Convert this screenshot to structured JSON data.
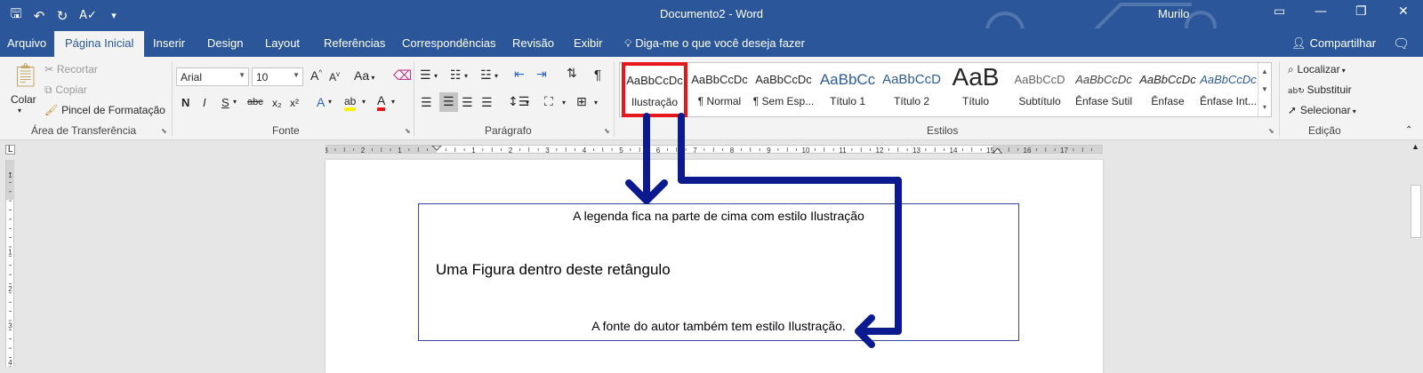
{
  "window": {
    "title": "Documento2 - Word",
    "user": "Murilo",
    "qat_icons": [
      "save-icon",
      "undo-icon",
      "redo-icon",
      "spelling-icon",
      "customize-icon"
    ],
    "controls": [
      "ribbon-display-icon",
      "minimize-icon",
      "restore-icon",
      "close-icon"
    ]
  },
  "tabs": [
    {
      "label": "Arquivo"
    },
    {
      "label": "Página Inicial",
      "active": true
    },
    {
      "label": "Inserir"
    },
    {
      "label": "Design"
    },
    {
      "label": "Layout"
    },
    {
      "label": "Referências"
    },
    {
      "label": "Correspondências"
    },
    {
      "label": "Revisão"
    },
    {
      "label": "Exibir"
    }
  ],
  "tell_me": "Diga-me o que você deseja fazer",
  "share": "Compartilhar",
  "clipboard": {
    "paste": "Colar",
    "cut": "Recortar",
    "copy": "Copiar",
    "format_painter": "Pincel de Formatação",
    "group": "Área de Transferência"
  },
  "font": {
    "name": "Arial",
    "size": "10",
    "bold": "N",
    "italic": "I",
    "underline": "S",
    "strike": "abc",
    "subscript": "x₂",
    "superscript": "x²",
    "change_case": "Aa",
    "grow": "A",
    "shrink": "A",
    "effects": "A",
    "highlight": "ab",
    "color": "A",
    "group": "Fonte"
  },
  "paragraph": {
    "group": "Parágrafo",
    "pilcrow": "¶"
  },
  "styles": {
    "group": "Estilos",
    "items": [
      {
        "preview": "AaBbCcDc",
        "label": "Ilustração",
        "selected": true
      },
      {
        "preview": "AaBbCcDc",
        "label": "¶ Normal"
      },
      {
        "preview": "AaBbCcDc",
        "label": "¶ Sem Esp..."
      },
      {
        "preview": "AaBbCc",
        "label": "Título 1"
      },
      {
        "preview": "AaBbCcD",
        "label": "Título 2"
      },
      {
        "preview": "AaB",
        "label": "Título"
      },
      {
        "preview": "AaBbCcD",
        "label": "Subtítulo"
      },
      {
        "preview": "AaBbCcDc",
        "label": "Ênfase Sutil"
      },
      {
        "preview": "AaBbCcDc",
        "label": "Ênfase"
      },
      {
        "preview": "AaBbCcDc",
        "label": "Ênfase Int..."
      }
    ]
  },
  "editing": {
    "group": "Edição",
    "find": "Localizar",
    "replace": "Substituir",
    "select": "Selecionar"
  },
  "ruler": {
    "labels": [
      "3",
      "2",
      "1",
      "1",
      "2",
      "3",
      "4",
      "5",
      "6",
      "7",
      "8",
      "9",
      "10",
      "11",
      "12",
      "13",
      "14",
      "15",
      "16",
      "17"
    ],
    "vlabels": [
      "1",
      "1",
      "2",
      "3",
      "4"
    ]
  },
  "document": {
    "caption_top": "A legenda fica na parte de cima com estilo Ilustração",
    "figure_text": "Uma Figura dentro deste retângulo",
    "caption_bottom": "A fonte do autor também tem estilo Ilustração."
  },
  "colors": {
    "ribbon_blue": "#2b579a",
    "highlight_red": "#e8151b",
    "arrow_navy": "#0b1a8f",
    "figure_border": "#34459a"
  }
}
